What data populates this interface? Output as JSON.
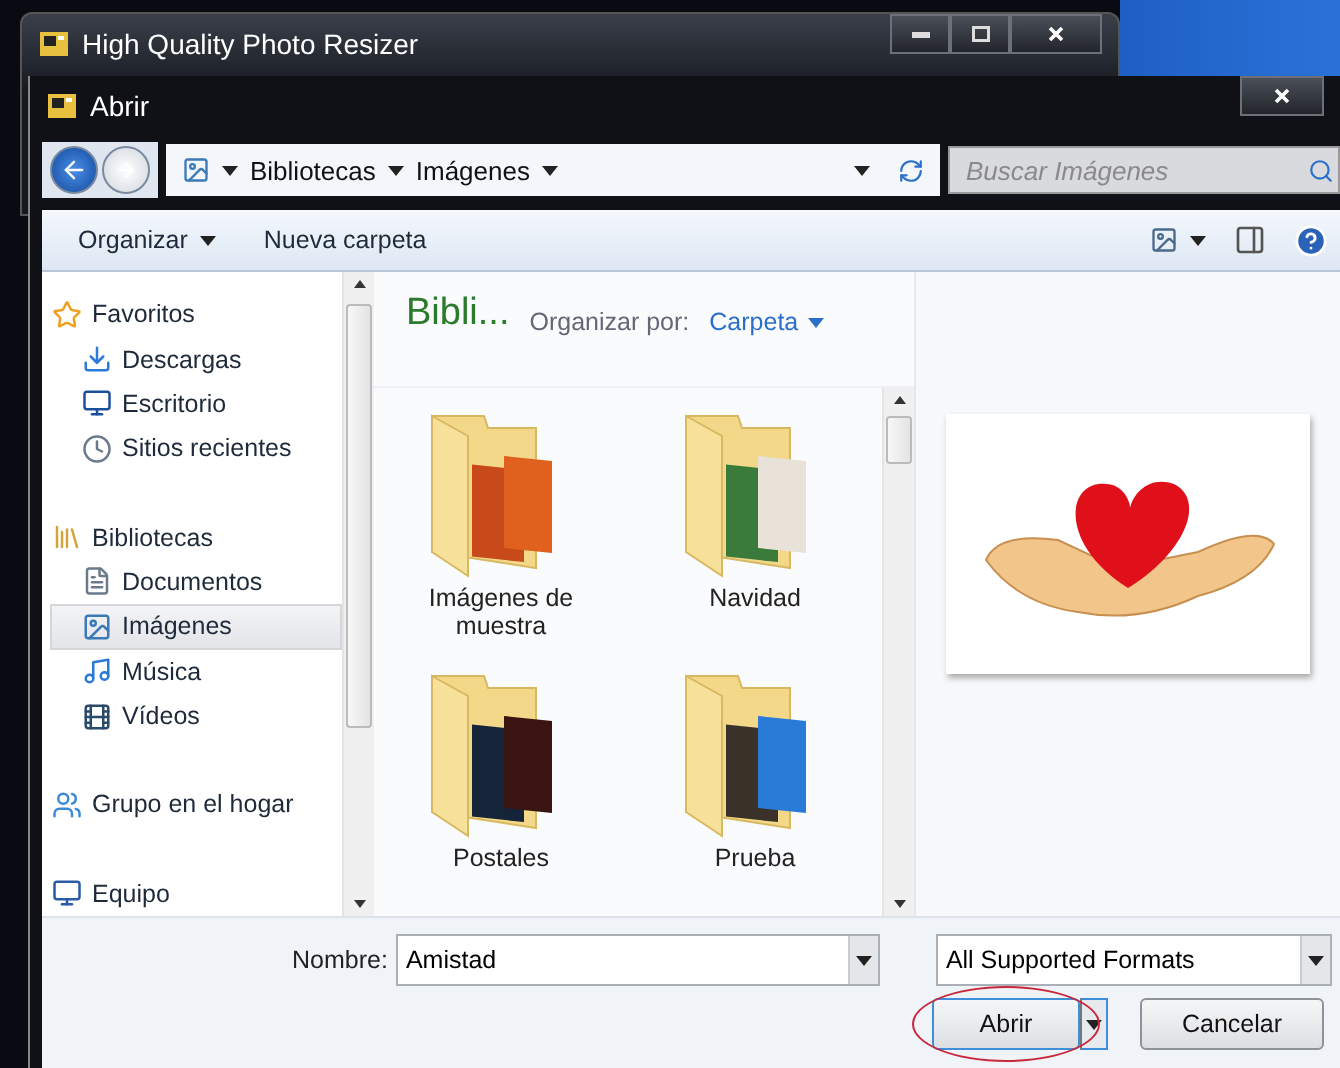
{
  "parent_window": {
    "title": "High Quality Photo Resizer"
  },
  "dialog": {
    "title": "Abrir"
  },
  "address_bar": {
    "breadcrumbs": [
      "Bibliotecas",
      "Imágenes"
    ]
  },
  "search": {
    "placeholder": "Buscar Imágenes"
  },
  "toolbar": {
    "buttons": [
      {
        "label": "Organizar",
        "kind": "menu"
      },
      {
        "label": "Nueva carpeta",
        "kind": "plain"
      }
    ]
  },
  "navigation": {
    "groups": [
      {
        "label": "Favoritos",
        "selected": false,
        "children": [
          {
            "label": "Descargas",
            "selected": false
          },
          {
            "label": "Escritorio",
            "selected": false
          },
          {
            "label": "Sitios recientes",
            "selected": false
          }
        ]
      },
      {
        "label": "Bibliotecas",
        "selected": false,
        "children": [
          {
            "label": "Documentos",
            "selected": false
          },
          {
            "label": "Imágenes",
            "selected": true
          },
          {
            "label": "Música",
            "selected": false
          },
          {
            "label": "Vídeos",
            "selected": false
          }
        ]
      },
      {
        "label": "Grupo en el hogar",
        "selected": false
      },
      {
        "label": "Equipo",
        "selected": false
      }
    ]
  },
  "library": {
    "title": "Bibli...",
    "arrange_label": "Organizar por:",
    "arrange_value": "Carpeta"
  },
  "folders": [
    {
      "name": "Imágenes de muestra"
    },
    {
      "name": "Navidad"
    },
    {
      "name": "Postales"
    },
    {
      "name": "Prueba"
    }
  ],
  "file_name": {
    "label": "Nombre:",
    "value": "Amistad"
  },
  "file_type": {
    "value": "All Supported Formats"
  },
  "buttons": [
    {
      "label": "Abrir",
      "kind": "primary",
      "highlighted": true
    },
    {
      "label": "Cancelar",
      "kind": "plain",
      "highlighted": false
    }
  ]
}
